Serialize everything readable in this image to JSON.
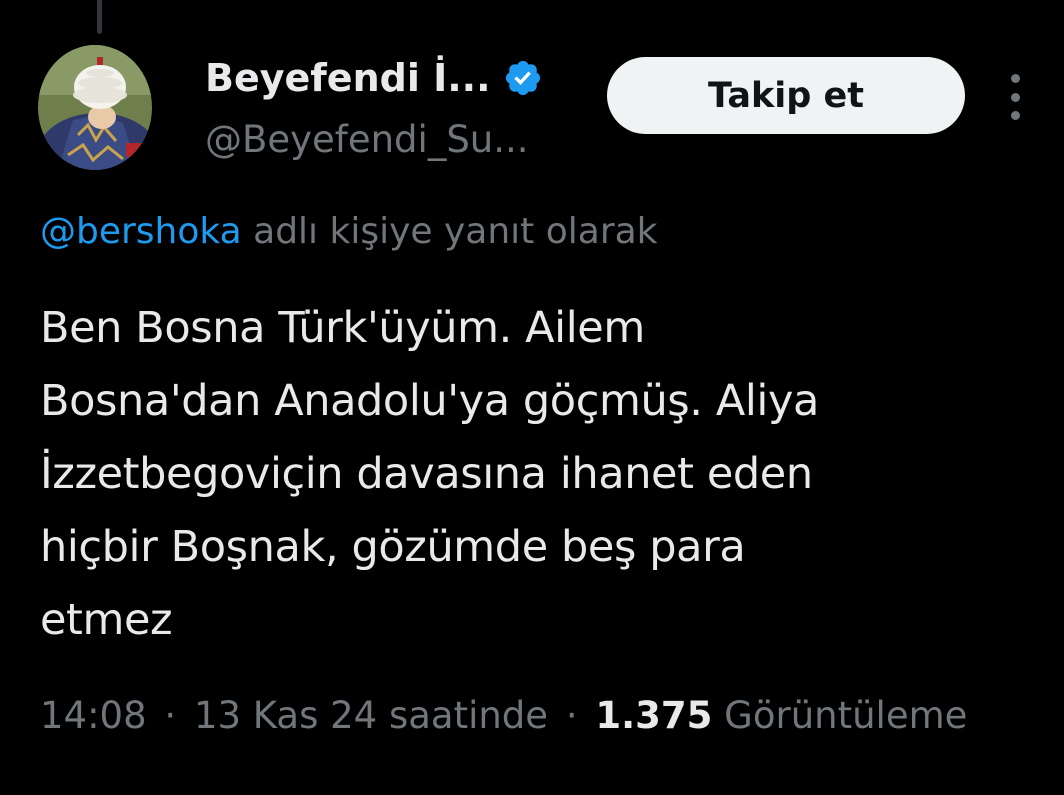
{
  "author": {
    "display_name": "Beyefendi İ...",
    "handle": "@Beyefendi_Su...",
    "verified": true,
    "avatar_icon": "avatar-ottoman-turban-icon"
  },
  "actions": {
    "follow_label": "Takip et",
    "more_icon": "more-vertical-icon"
  },
  "reply": {
    "mention": "@bershoka",
    "suffix": " adlı kişiye yanıt olarak"
  },
  "tweet": {
    "text": "Ben Bosna Türk'üyüm. Ailem\nBosna'dan Anadolu'ya göçmüş. Aliya\nİzzetbegoviçin davasına ihanet eden\nhiçbir Boşnak, gözümde beş para\netmez"
  },
  "meta": {
    "time": "14:08",
    "separator": "·",
    "date": "13 Kas 24 saatinde",
    "views_count": "1.375",
    "views_label": "Görüntüleme"
  },
  "colors": {
    "background": "#000000",
    "text_primary": "#e7e9ea",
    "text_secondary": "#71767b",
    "accent": "#1d9bf0",
    "button_bg": "#eff3f4"
  }
}
